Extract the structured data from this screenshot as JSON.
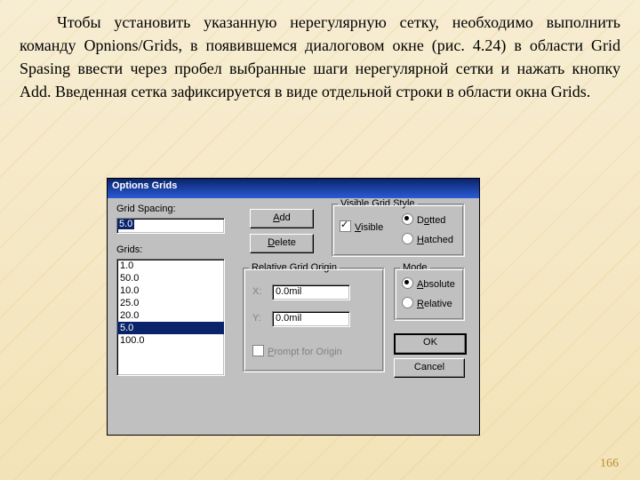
{
  "paragraph": "Чтобы установить указанную нерегулярную сетку, необходимо выполнить команду Opnions/Grids, в появившемся диалоговом окне (рис. 4.24) в области Grid Spasing ввести через пробел выбранные шаги нерегулярной сетки и нажать кнопку Add. Введенная сетка зафиксируется в виде отдельной строки в области окна Grids.",
  "page_number": "166",
  "dialog": {
    "title": "Options Grids",
    "grid_spacing_label": "Grid Spacing:",
    "grid_spacing_value": "5.0",
    "grids_label": "Grids:",
    "grids_items": [
      "1.0",
      "50.0",
      "10.0",
      "25.0",
      "20.0",
      "5.0",
      "100.0"
    ],
    "grids_selected_index": 5,
    "buttons": {
      "add": "Add",
      "delete": "Delete",
      "ok": "OK",
      "cancel": "Cancel"
    },
    "vgs": {
      "title": "Visible Grid Style",
      "visible": "Visible",
      "visible_checked": true,
      "dotted": "Dotted",
      "hatched": "Hatched",
      "style": "dotted"
    },
    "rgo": {
      "title": "Relative Grid Origin",
      "x_label": "X:",
      "x": "0.0mil",
      "y_label": "Y:",
      "y": "0.0mil",
      "prompt": "Prompt for Origin",
      "prompt_checked": false
    },
    "mode": {
      "title": "Mode",
      "absolute": "Absolute",
      "relative": "Relative",
      "value": "absolute"
    }
  }
}
